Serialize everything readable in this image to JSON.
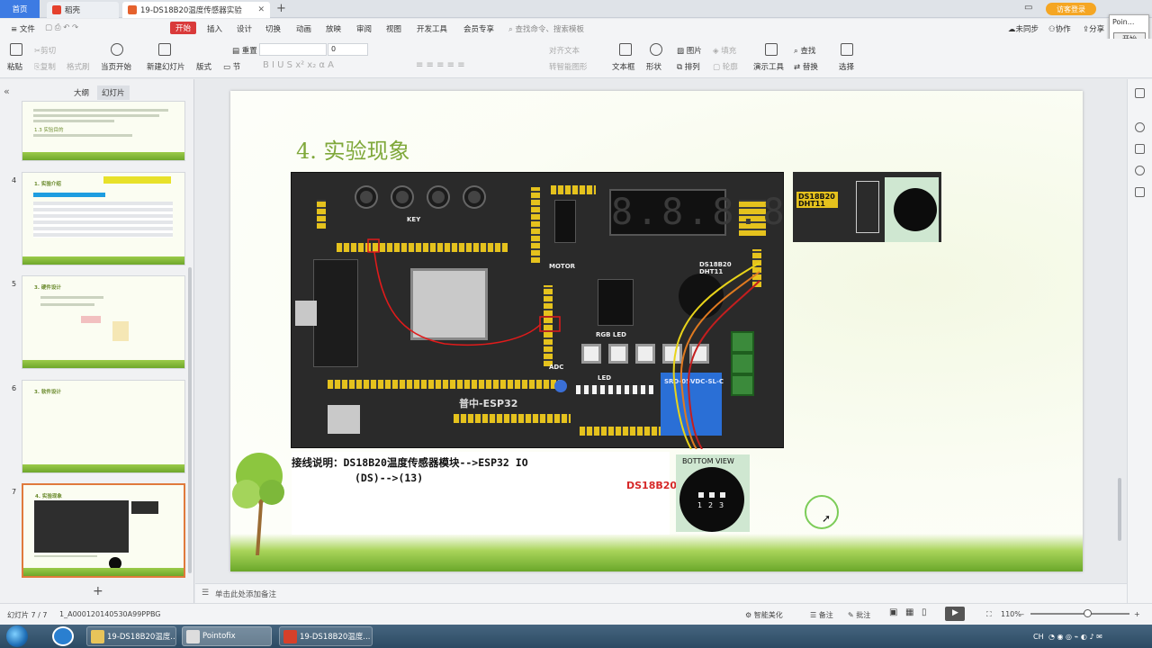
{
  "tabs": {
    "home": "首页",
    "daoke": "稻壳",
    "active": "19-DS18B20温度传感器实验",
    "new_tab": "+",
    "visitor": "访客登录"
  },
  "menu": {
    "file": "文件",
    "start": "开始",
    "insert": "插入",
    "design": "设计",
    "transition": "切换",
    "animation": "动画",
    "slideshow": "放映",
    "review": "审阅",
    "view": "视图",
    "developer": "开发工具",
    "member": "会员专享",
    "search": "查找命令、搜索模板",
    "unsync": "未同步",
    "collab": "协作",
    "share": "分享"
  },
  "popup": {
    "title": "Poin...",
    "start": "开始"
  },
  "toolbar": {
    "paste": "粘贴",
    "cut": "剪切",
    "copy": "复制",
    "format_painter": "格式刷",
    "from_current": "当页开始",
    "new_slide": "新建幻灯片",
    "layout": "版式",
    "section": "节",
    "reset": "重置",
    "font_size": "0",
    "align_text": "对齐文本",
    "convert_smartart": "转智能图形",
    "textbox": "文本框",
    "shape": "形状",
    "picture": "图片",
    "fill": "填充",
    "arrange": "排列",
    "outline": "轮廓",
    "presenter_tools": "演示工具",
    "find": "查找",
    "replace": "替换",
    "select": "选择"
  },
  "left_panel": {
    "outline_tab": "大纲",
    "slides_tab": "幻灯片",
    "collapse_icon": "double-chevron-left-icon",
    "add": "+",
    "slides": [
      {
        "num": "",
        "title": "1.3 实验目的"
      },
      {
        "num": "4",
        "title": "1. 实验介绍"
      },
      {
        "num": "5",
        "title": "3. 硬件设计"
      },
      {
        "num": "6",
        "title": "3. 软件设计"
      },
      {
        "num": "7",
        "title": "4. 实验现象"
      }
    ]
  },
  "slide": {
    "title": "4. 实验现象",
    "board_labels": {
      "key": "KEY",
      "motor": "MOTOR",
      "rgb": "RGB LED",
      "adc": "ADC",
      "brand": "普中-ESP32",
      "ds18b20": "DS18B20",
      "dht11": "DHT11",
      "relay": "SRD-05VDC-SL-C",
      "led": "LED",
      "digits": "8.8.8.8"
    },
    "wiring_line1": "接线说明：DS18B20温度传感器模块-->ESP32 IO",
    "wiring_line2": "(DS)-->(13)",
    "ds_label": "DS18B20",
    "bottom_view": "BOTTOM VIEW",
    "pins": [
      "1",
      "2",
      "3"
    ],
    "inset_label1": "DS18B20",
    "inset_label2": "DHT11"
  },
  "notes": {
    "placeholder": "单击此处添加备注"
  },
  "status": {
    "slide_pos": "幻灯片 7 / 7",
    "file_id": "1_A000120140530A99PPBG",
    "beautify": "智能美化",
    "notes": "备注",
    "comments": "批注",
    "zoom": "110%"
  },
  "taskbar": {
    "items": [
      "19-DS18B20温度...",
      "Pointofix",
      "19-DS18B20温度..."
    ],
    "tray_lang": "CH"
  },
  "colors": {
    "accent_red": "#d93a3a",
    "title_green": "#7fa83a",
    "ds_label_red": "#d62828",
    "selected_thumb": "#e07a3c"
  }
}
